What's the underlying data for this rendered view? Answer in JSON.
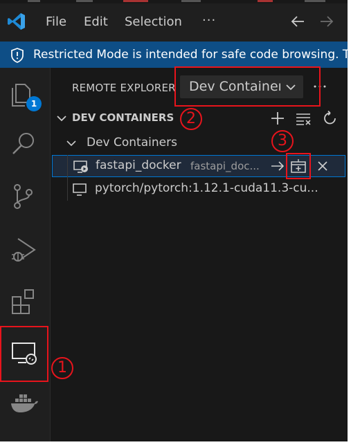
{
  "menu": {
    "file": "File",
    "edit": "Edit",
    "selection": "Selection",
    "more": "···"
  },
  "banner": {
    "text": "Restricted Mode is intended for safe code browsing. Tru"
  },
  "activity_bar": {
    "explorer_badge": "1",
    "items": [
      "explorer-icon",
      "search-icon",
      "source-control-icon",
      "run-debug-icon",
      "extensions-icon",
      "remote-explorer-icon",
      "docker-icon"
    ]
  },
  "sidebar": {
    "view_title": "REMOTE EXPLORER",
    "remote_select": "Dev Container",
    "view_more": "···",
    "section_title": "DEV CONTAINERS",
    "group_label": "Dev Containers",
    "containers": [
      {
        "name": "fastapi_docker",
        "description": "fastapi_doc..."
      },
      {
        "name": "pytorch/pytorch:1.12.1-cuda11.3-cu...",
        "description": ""
      }
    ]
  },
  "annotations": {
    "one": "1",
    "two": "2",
    "three": "3"
  },
  "colors": {
    "background": "#1f1f1f",
    "sidebar": "#181818",
    "banner": "#0e4e86",
    "accent": "#0078d4",
    "annotation": "#e8141c"
  }
}
